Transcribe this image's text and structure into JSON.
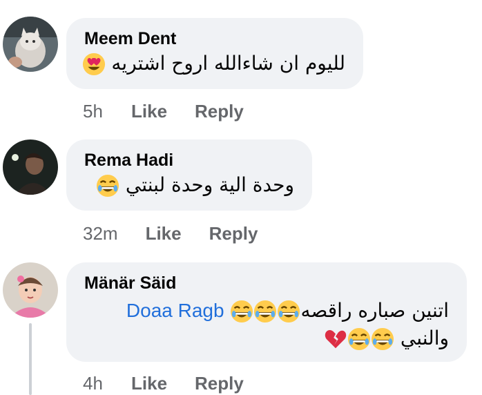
{
  "comments": [
    {
      "author": "Meem Dent",
      "text": "لليوم ان شاءالله اروح اشتريه",
      "emoji": [
        "heart-eyes-icon"
      ],
      "time": "5h",
      "like": "Like",
      "reply": "Reply"
    },
    {
      "author": "Rema Hadi",
      "text": "وحدة الية وحدة لبنتي",
      "emoji": [
        "laughing-icon"
      ],
      "time": "32m",
      "like": "Like",
      "reply": "Reply"
    },
    {
      "author": "Mänär Säid",
      "mention": "Doaa Ragb",
      "text_line1": "اتنين صباره راقصه",
      "text_line2": "والنبي",
      "emoji_line1": [
        "laughing-icon",
        "laughing-icon",
        "laughing-icon"
      ],
      "emoji_line2": [
        "broken-heart-icon",
        "laughing-icon",
        "laughing-icon"
      ],
      "time": "4h",
      "like": "Like",
      "reply": "Reply"
    }
  ],
  "colors": {
    "bubble": "#f0f2f5",
    "meta": "#65676b",
    "mention": "#216fdb"
  }
}
